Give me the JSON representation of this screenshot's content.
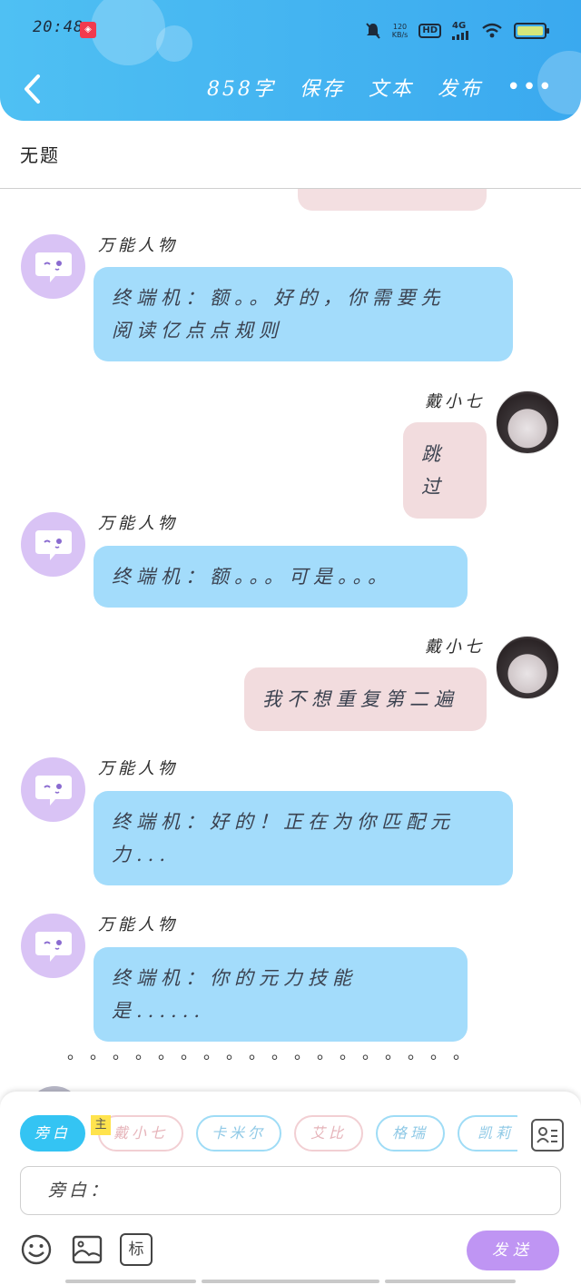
{
  "status": {
    "time": "20:48",
    "net_speed_value": "120",
    "net_speed_unit": "KB/s",
    "hd": "HD",
    "signal": "4G"
  },
  "nav": {
    "word_count": "858字",
    "save": "保存",
    "text": "文本",
    "publish": "发布",
    "more": "•••"
  },
  "title": "无题",
  "messages": [
    {
      "sender": "万能人物",
      "lines": [
        "终端机：额。。好的，你需要先",
        "阅读亿点点规则"
      ]
    },
    {
      "sender": "戴小七",
      "lines": [
        "跳过"
      ]
    },
    {
      "sender": "万能人物",
      "lines": [
        "终端机：额。。。可是。。。"
      ]
    },
    {
      "sender": "戴小七",
      "lines": [
        "我不想重复第二遍"
      ]
    },
    {
      "sender": "万能人物",
      "lines": [
        "终端机：好的！正在为你匹配元",
        "力..."
      ]
    },
    {
      "sender": "万能人物",
      "lines": [
        "终端机：你的元力技能是......"
      ]
    }
  ],
  "dots_line": "。。。。。。。。。。。。。。。。。。",
  "roles": {
    "narration": "旁白",
    "main_tag": "主",
    "chips": [
      "戴小七",
      "卡米尔",
      "艾比",
      "格瑞",
      "凯莉"
    ]
  },
  "input": {
    "value": "旁白："
  },
  "tools": {
    "mark_label": "标"
  },
  "send": "发送",
  "colors": {
    "header": "#3aa9ef",
    "bot_bubble": "#a3dcfb",
    "user_bubble": "#f2dcde",
    "bot_avatar": "#d9c3f5",
    "send_button": "#bf95f3",
    "active_chip": "#34c4f3"
  }
}
